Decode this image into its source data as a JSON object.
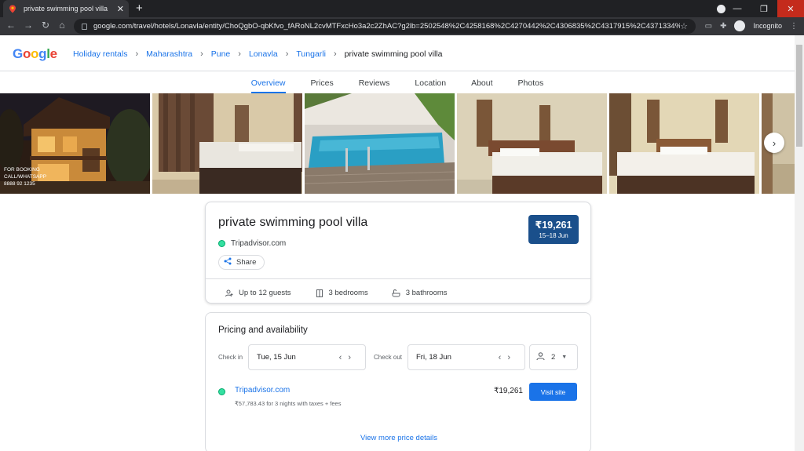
{
  "browser": {
    "tab_title": "private swimming pool villa",
    "url": "google.com/travel/hotels/Lonavla/entity/ChoQgbO-qbKfvo_fARoNL2cvMTFxcHo3a2c2ZhAC?g2lb=2502548%2C4258168%2C4270442%2C4306835%2C4317915%2C4371334%2C4...",
    "incognito_label": "Incognito"
  },
  "header": {
    "logo": "Google",
    "breadcrumbs": [
      "Holiday rentals",
      "Maharashtra",
      "Pune",
      "Lonavla",
      "Tungarli",
      "private swimming pool villa"
    ]
  },
  "subnav": {
    "tabs": [
      "Overview",
      "Prices",
      "Reviews",
      "Location",
      "About",
      "Photos"
    ],
    "active": "Overview"
  },
  "photos": {
    "overlay_lines": [
      "FOR BOOKING",
      "CALL/WHATSAPP",
      "8888 92 1235"
    ]
  },
  "overview": {
    "title": "private swimming pool villa",
    "provider": "Tripadvisor.com",
    "share_label": "Share",
    "price": "₹19,261",
    "price_dates": "15–18 Jun",
    "amenities": [
      "Up to 12 guests",
      "3 bedrooms",
      "3 bathrooms"
    ]
  },
  "pricing": {
    "title": "Pricing and availability",
    "checkin_label": "Check in",
    "checkin_value": "Tue, 15 Jun",
    "checkout_label": "Check out",
    "checkout_value": "Fri, 18 Jun",
    "guests": "2",
    "offer_provider": "Tripadvisor.com",
    "offer_detail": "₹57,783.43 for 3 nights with taxes + fees",
    "offer_price": "₹19,261",
    "visit_label": "Visit site",
    "more_link": "View more price details"
  },
  "colors": {
    "accent": "#1a73e8",
    "price_badge": "#1a4f8b",
    "tripadvisor": "#34e0a1"
  }
}
